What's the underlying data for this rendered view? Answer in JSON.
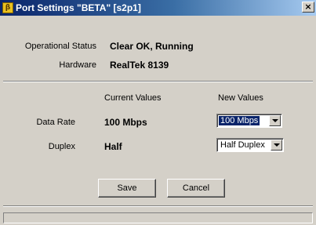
{
  "window": {
    "title": "Port Settings  \"BETA\"  [s2p1]",
    "icon": "app-icon",
    "close_label": "×"
  },
  "info": {
    "status_label": "Operational Status",
    "status_value": "Clear OK, Running",
    "hardware_label": "Hardware",
    "hardware_value": "RealTek 8139"
  },
  "settings": {
    "current_header": "Current Values",
    "new_header": "New Values",
    "rows": [
      {
        "label": "Data Rate",
        "current": "100 Mbps",
        "new": "100 Mbps"
      },
      {
        "label": "Duplex",
        "current": "Half",
        "new": "Half Duplex"
      }
    ]
  },
  "buttons": {
    "save": "Save",
    "cancel": "Cancel"
  },
  "colors": {
    "title_bar_start": "#0a246a",
    "title_bar_end": "#a6caf0",
    "face": "#d4d0c8",
    "selection": "#0a246a"
  }
}
